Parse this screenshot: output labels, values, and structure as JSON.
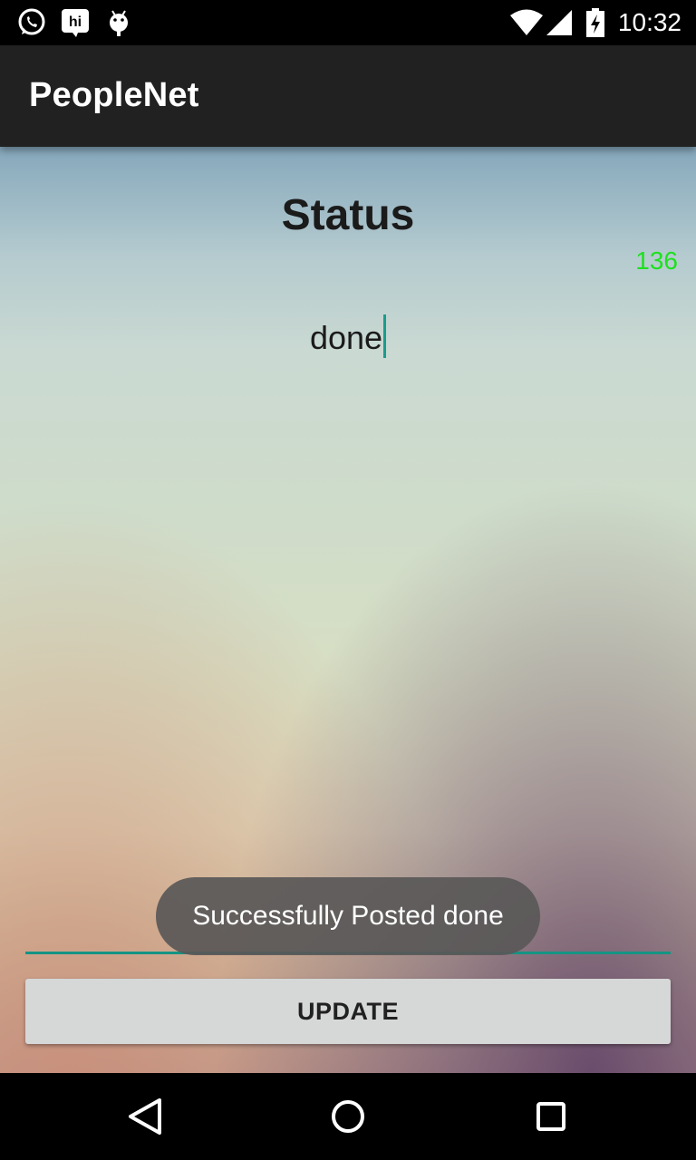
{
  "status_bar": {
    "time": "10:32",
    "left_icons": [
      "whatsapp-icon",
      "hike-icon",
      "android-icon"
    ],
    "right_icons": [
      "wifi-icon",
      "cell-signal-icon",
      "battery-charging-icon"
    ]
  },
  "app_bar": {
    "title": "PeopleNet"
  },
  "main": {
    "heading": "Status",
    "char_count": "136",
    "status_text": "done",
    "update_label": "UPDATE"
  },
  "toast": {
    "message": "Successfully Posted done"
  },
  "nav_bar": {
    "icons": [
      "back-icon",
      "home-icon",
      "recents-icon"
    ]
  },
  "colors": {
    "app_bar": "#212121",
    "accent": "#159484",
    "char_count": "#1ee01e",
    "toast": "#5a5858"
  }
}
